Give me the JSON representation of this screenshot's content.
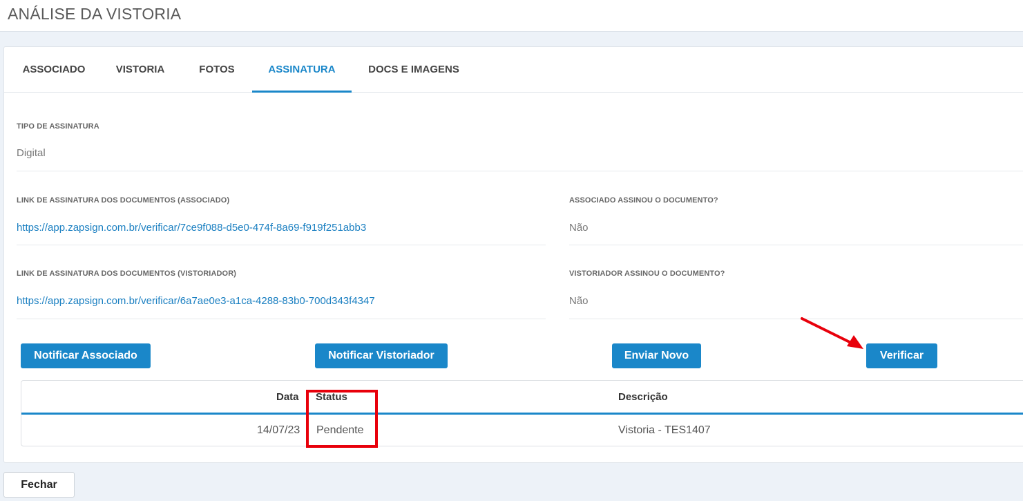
{
  "header": {
    "title": "ANÁLISE DA VISTORIA"
  },
  "tabs": [
    {
      "label": "ASSOCIADO"
    },
    {
      "label": "VISTORIA"
    },
    {
      "label": "FOTOS"
    },
    {
      "label": "ASSINATURA",
      "active": true
    },
    {
      "label": "DOCS E IMAGENS"
    }
  ],
  "fields": {
    "tipo_label": "TIPO DE ASSINATURA",
    "tipo_value": "Digital",
    "link_associado_label": "LINK DE ASSINATURA DOS DOCUMENTOS (ASSOCIADO)",
    "link_associado_value": "https://app.zapsign.com.br/verificar/7ce9f088-d5e0-474f-8a69-f919f251abb3",
    "associado_assinou_label": "ASSOCIADO ASSINOU O DOCUMENTO?",
    "associado_assinou_value": "Não",
    "link_vistoriador_label": "LINK DE ASSINATURA DOS DOCUMENTOS (VISTORIADOR)",
    "link_vistoriador_value": "https://app.zapsign.com.br/verificar/6a7ae0e3-a1ca-4288-83b0-700d343f4347",
    "vistoriador_assinou_label": "VISTORIADOR ASSINOU O DOCUMENTO?",
    "vistoriador_assinou_value": "Não"
  },
  "buttons": {
    "notificar_associado": "Notificar Associado",
    "notificar_vistoriador": "Notificar Vistoriador",
    "enviar_novo": "Enviar Novo",
    "verificar": "Verificar",
    "fechar": "Fechar"
  },
  "table": {
    "columns": [
      "Data",
      "Status",
      "Descrição"
    ],
    "rows": [
      {
        "data": "14/07/23",
        "status": "Pendente",
        "descricao": "Vistoria - TES1407"
      }
    ]
  },
  "annotations": {
    "highlight_color": "#e8000b",
    "accent_color": "#1a87c9"
  }
}
